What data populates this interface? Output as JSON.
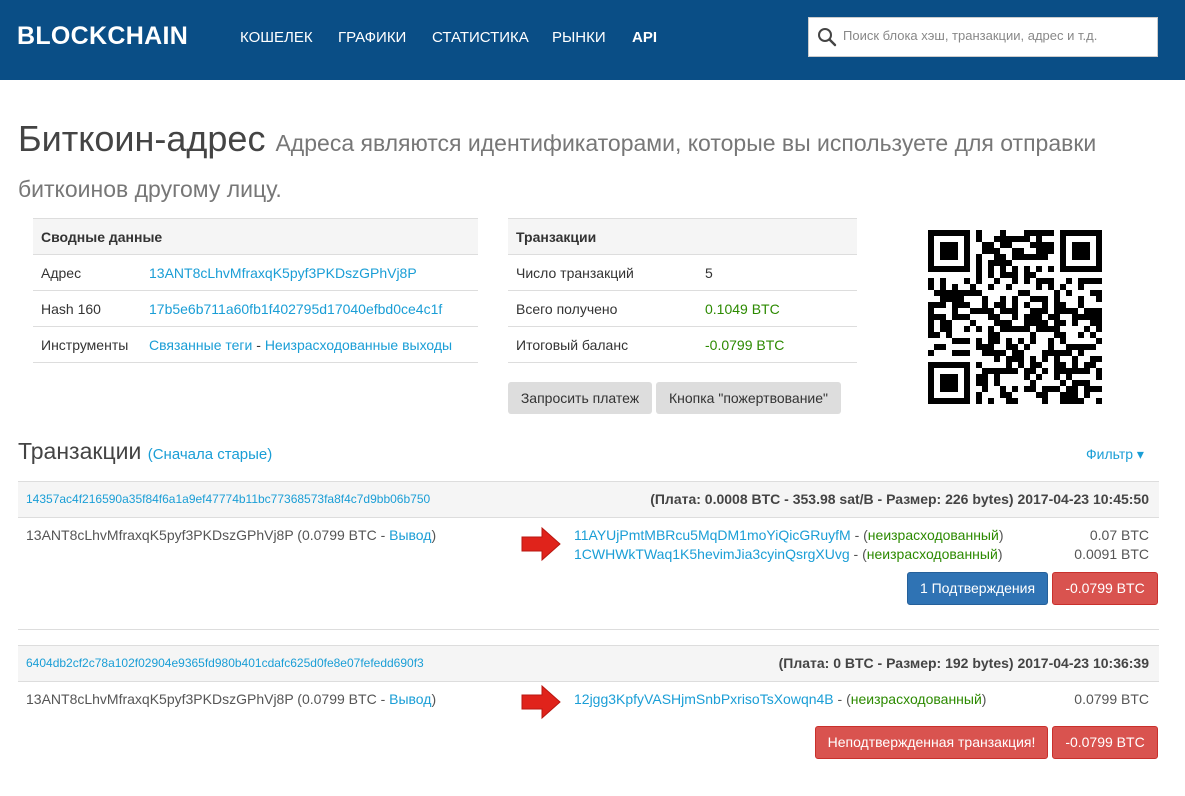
{
  "nav": {
    "logo": "BLOCKCHAIN",
    "links": [
      "КОШЕЛЕК",
      "ГРАФИКИ",
      "СТАТИСТИКА",
      "РЫНКИ",
      "API"
    ],
    "search_placeholder": "Поиск блока хэш, транзакции, адрес и т.д."
  },
  "header": {
    "title": "Биткоин-адрес",
    "subtitle": "Адреса являются идентификаторами, которые вы используете для отправки биткоинов другому лицу."
  },
  "summary": {
    "heading": "Сводные данные",
    "address_label": "Адрес",
    "address_value": "13ANT8cLhvMfraxqK5pyf3PKDszGPhVj8P",
    "hash_label": "Hash 160",
    "hash_value": "17b5e6b711a60fb1f402795d17040efbd0ce4c1f",
    "tools_label": "Инструменты",
    "tools_link1": "Связанные теги",
    "tools_sep": " - ",
    "tools_link2": "Неизрасходованные выходы"
  },
  "transactions_table": {
    "heading": "Транзакции",
    "count_label": "Число транзакций",
    "count_value": "5",
    "received_label": "Всего получено",
    "received_value": "0.1049 BTC",
    "balance_label": "Итоговый баланс",
    "balance_value": "-0.0799 BTC",
    "btn_request": "Запросить платеж",
    "btn_donate": "Кнопка \"пожертвование\""
  },
  "tx_section": {
    "title": "Транзакции",
    "subtitle": "(Сначала старые)",
    "filter": "Фильтр ▾"
  },
  "txs": [
    {
      "hash": "14357ac4f216590a35f84f6a1a9ef47774b11bc77368573fa8f4c7d9bb06b750",
      "meta": "(Плата: 0.0008 BTC - 353.98 sat/B - Размер: 226 bytes) 2017-04-23 10:45:50",
      "input_text": "13ANT8cLhvMfraxqK5pyf3PKDszGPhVj8P (0.0799 BTC - ",
      "input_link": "Вывод",
      "input_close": ")",
      "outputs": [
        {
          "addr": "11AYUjPmtMBRcu5MqDM1moYiQicGRuyfM",
          "pre": " - (",
          "status": "неизрасходованный",
          "post": ")",
          "amount": "0.07 BTC"
        },
        {
          "addr": "1CWHWkTWaq1K5hevimJia3cyinQsrgXUvg",
          "pre": " - (",
          "status": "неизрасходованный",
          "post": ")",
          "amount": "0.0091 BTC"
        }
      ],
      "status_button": "1 Подтверждения",
      "amount_button": "-0.0799 BTC"
    },
    {
      "hash": "6404db2cf2c78a102f02904e9365fd980b401cdafc625d0fe8e07fefedd690f3",
      "meta": "(Плата: 0 BTC - Размер: 192 bytes) 2017-04-23 10:36:39",
      "input_text": "13ANT8cLhvMfraxqK5pyf3PKDszGPhVj8P (0.0799 BTC - ",
      "input_link": "Вывод",
      "input_close": ")",
      "outputs": [
        {
          "addr": "12jgg3KpfyVASHjmSnbPxrisoTsXowqn4B",
          "pre": " - (",
          "status": "неизрасходованный",
          "post": ")",
          "amount": "0.0799 BTC"
        }
      ],
      "status_button": "Неподтвержденная транзакция!",
      "amount_button": "-0.0799 BTC"
    }
  ],
  "colors": {
    "navbar": "#0a4e86",
    "link": "#1a9ed6",
    "green": "#2c8a00",
    "confirm_blue": "#2f73b4",
    "red": "#d9534f",
    "arrow_red": "#e0231b"
  },
  "icons": [
    "search-icon",
    "qr-code-image",
    "arrow-right-icon"
  ]
}
